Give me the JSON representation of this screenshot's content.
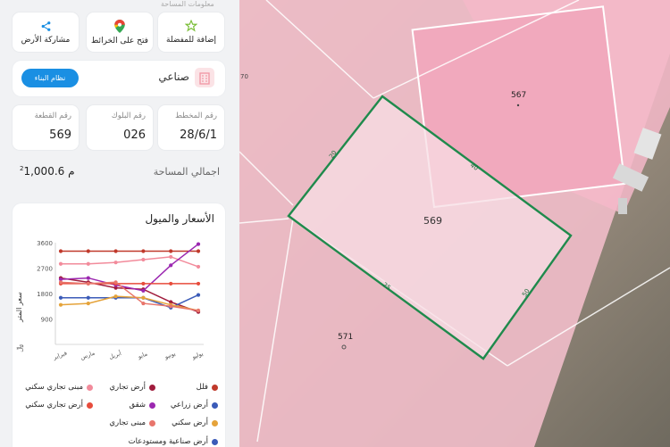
{
  "top_clip": "معلومات المساحة",
  "actions": [
    {
      "label": "إضافة للمفضلة",
      "icon": "star-icon"
    },
    {
      "label": "فتح على الخرائط",
      "icon": "map-pin-icon"
    },
    {
      "label": "مشاركة الأرض",
      "icon": "share-icon"
    }
  ],
  "usage": {
    "label": "صناعي",
    "button": "نظام البناء",
    "icon": "building-icon"
  },
  "stats": [
    {
      "key": "رقم المخطط",
      "value": "28/6/1"
    },
    {
      "key": "رقم البلوك",
      "value": "026"
    },
    {
      "key": "رقم القطعة",
      "value": "569"
    }
  ],
  "area": {
    "label": "اجمالي المساحة",
    "value": "1,000.6",
    "unit": "م",
    "unit_sup": "2"
  },
  "chart_title": "الأسعار والميول",
  "chart_data": {
    "type": "line",
    "categories": [
      "فبراير",
      "مارس",
      "أبريل",
      "مايو",
      "يونيو",
      "يوليو"
    ],
    "ylabel": "سعر المتر",
    "ylabel_icon": "﷼",
    "ylim": [
      0,
      3600
    ],
    "yticks": [
      900,
      1800,
      2700,
      3600
    ],
    "yticklabels": [
      "900",
      "1800",
      "2700",
      "3600"
    ],
    "series": [
      {
        "name": "فلل",
        "color": "#c0392b",
        "values": [
          3300,
          3300,
          3300,
          3300,
          3300,
          3300
        ]
      },
      {
        "name": "أرض تجاري",
        "color": "#a01c3c",
        "values": [
          2350,
          2200,
          2000,
          1950,
          1500,
          1150
        ]
      },
      {
        "name": "مبنى تجاري سكني",
        "color": "#f28b9b",
        "values": [
          2850,
          2850,
          2900,
          3000,
          3100,
          2750
        ]
      },
      {
        "name": "أرض زراعي",
        "color": "#3b5bb8",
        "values": [
          1650,
          1650,
          1650,
          1650,
          1300,
          1750
        ]
      },
      {
        "name": "شقق",
        "color": "#9b27b0",
        "values": [
          2300,
          2350,
          2100,
          1900,
          2800,
          3550
        ]
      },
      {
        "name": "أرض تجاري سكني",
        "color": "#e74c3c",
        "values": [
          2150,
          2150,
          2150,
          2150,
          2150,
          2150
        ]
      },
      {
        "name": "أرض سكني",
        "color": "#e5a33a",
        "values": [
          1400,
          1450,
          1700,
          1650,
          1400,
          1200
        ]
      },
      {
        "name": "مبنى تجاري",
        "color": "#e8756b",
        "values": [
          2200,
          2150,
          2200,
          1450,
          1350,
          1200
        ]
      }
    ],
    "partial_legend": "أرض صناعية ومستودعات"
  },
  "map": {
    "parcel_main": "569",
    "parcel_ne": "567",
    "parcel_sw": "571",
    "edge_nw": "20",
    "edge_ne": "40",
    "edge_se": "50",
    "edge_sw": "25",
    "tick_left": "70"
  }
}
